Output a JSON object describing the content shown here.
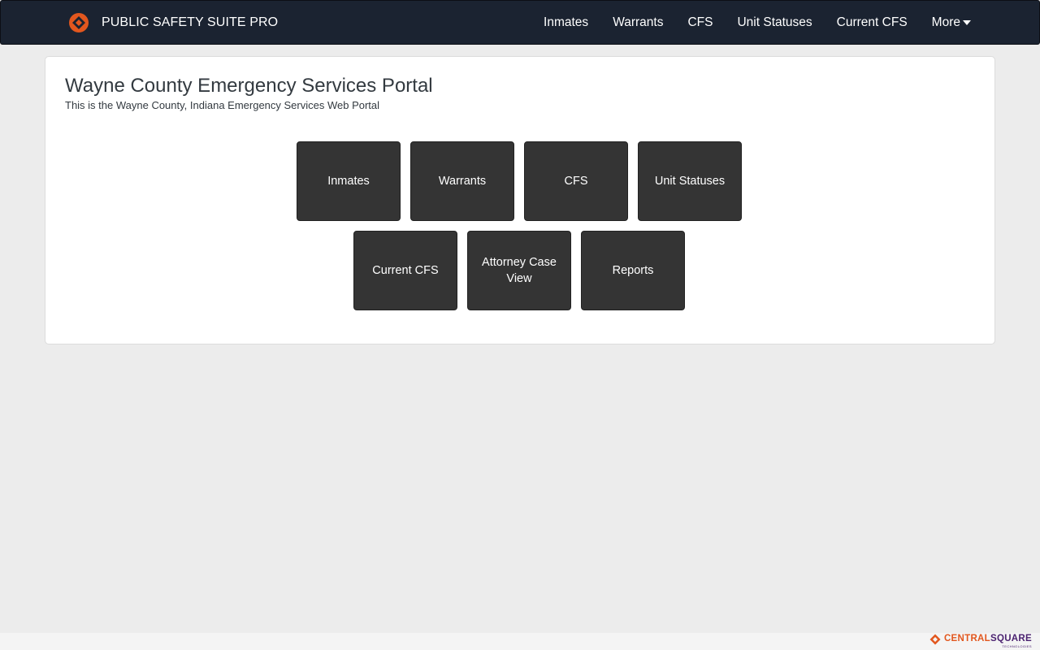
{
  "app": {
    "brand_name": "PUBLIC SAFETY SUITE PRO",
    "brand_logo_icon": "diamond-logo-icon",
    "accent_color": "#e2571e"
  },
  "nav": {
    "items": [
      {
        "label": "Inmates"
      },
      {
        "label": "Warrants"
      },
      {
        "label": "CFS"
      },
      {
        "label": "Unit Statuses"
      },
      {
        "label": "Current CFS"
      }
    ],
    "more_label": "More"
  },
  "main": {
    "title": "Wayne County Emergency Services Portal",
    "subtitle": "This is the Wayne County, Indiana Emergency Services Web Portal",
    "tiles": [
      {
        "label": "Inmates"
      },
      {
        "label": "Warrants"
      },
      {
        "label": "CFS"
      },
      {
        "label": "Unit Statuses"
      },
      {
        "label": "Current CFS"
      },
      {
        "label": "Attorney Case View"
      },
      {
        "label": "Reports"
      }
    ]
  },
  "footer": {
    "brand_part1": "CENTRAL",
    "brand_part2": "SQUARE",
    "tagline": "TECHNOLOGIES",
    "logo_icon": "centralsquare-logo-icon"
  }
}
